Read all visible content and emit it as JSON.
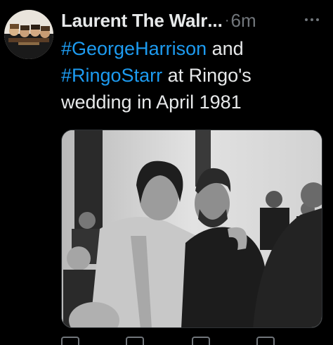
{
  "tweet": {
    "author_name": "Laurent The Walr",
    "author_name_ellipsis": "...",
    "separator": "·",
    "timestamp": "6m",
    "text_parts": {
      "hashtag_1": "#GeorgeHarrison",
      "text_1": " and",
      "hashtag_2": "#RingoStarr",
      "text_2": " at Ringo's wedding in April 1981"
    },
    "avatar_icon": "group-photo-avatar",
    "media_icon": "black-and-white-photo",
    "more_icon": "more-horizontal-icon"
  },
  "colors": {
    "background": "#000000",
    "text_primary": "#e7e9ea",
    "text_secondary": "#71767b",
    "accent": "#1d9bf0"
  }
}
